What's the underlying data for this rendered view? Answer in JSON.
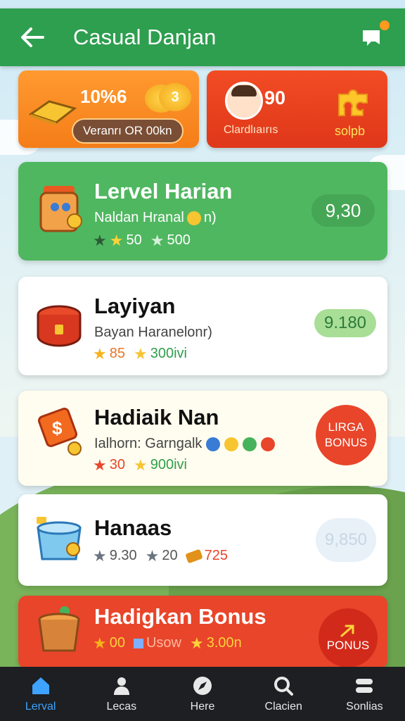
{
  "header": {
    "title": "Casual Danjan",
    "back_icon": "arrow-left-icon",
    "bell_icon": "bell-icon"
  },
  "stats": {
    "left": {
      "percent": "10%6",
      "coin_label": "3",
      "pill": "Veranrı OR 00kn"
    },
    "right": {
      "value": "90",
      "label": "Clardlıaırıs",
      "secondary": "solpb"
    }
  },
  "cards": [
    {
      "title": "Lervel Harian",
      "subtitle": "Naldan Hranal",
      "subtitle_tail": "n)",
      "stat1": "50",
      "stat2": "500",
      "badge": "9,30",
      "bg": "#4fb760"
    },
    {
      "title": "Layiyan",
      "subtitle": "Bayan Haranelonr)",
      "stat1": "85",
      "stat2": "300ivi",
      "badge": "9.180",
      "bg": "#ffffff"
    },
    {
      "title": "Hadiaik Nan",
      "subtitle": "Ialhorn: Garngalk",
      "stat1": "30",
      "stat2": "900ivi",
      "badge_top": "LIRGA",
      "badge_bottom": "BONUS",
      "bg": "#fffdef"
    },
    {
      "title": "Hanaas",
      "stat1": "9.30",
      "stat2": "20",
      "stat3": "725",
      "badge": "9,850",
      "bg": "#ffffff"
    },
    {
      "title": "Hadigkan Bonus",
      "stat1": "00",
      "stat2": "Usow",
      "stat3": "3.00n",
      "badge": "PONUS",
      "bg": "#e8452a"
    }
  ],
  "nav": [
    {
      "label": "Lerval",
      "icon": "home-icon",
      "active": true
    },
    {
      "label": "Lecas",
      "icon": "person-icon"
    },
    {
      "label": "Here",
      "icon": "compass-icon"
    },
    {
      "label": "Clacien",
      "icon": "search-icon"
    },
    {
      "label": "Sonlias",
      "icon": "menu-icon"
    }
  ]
}
